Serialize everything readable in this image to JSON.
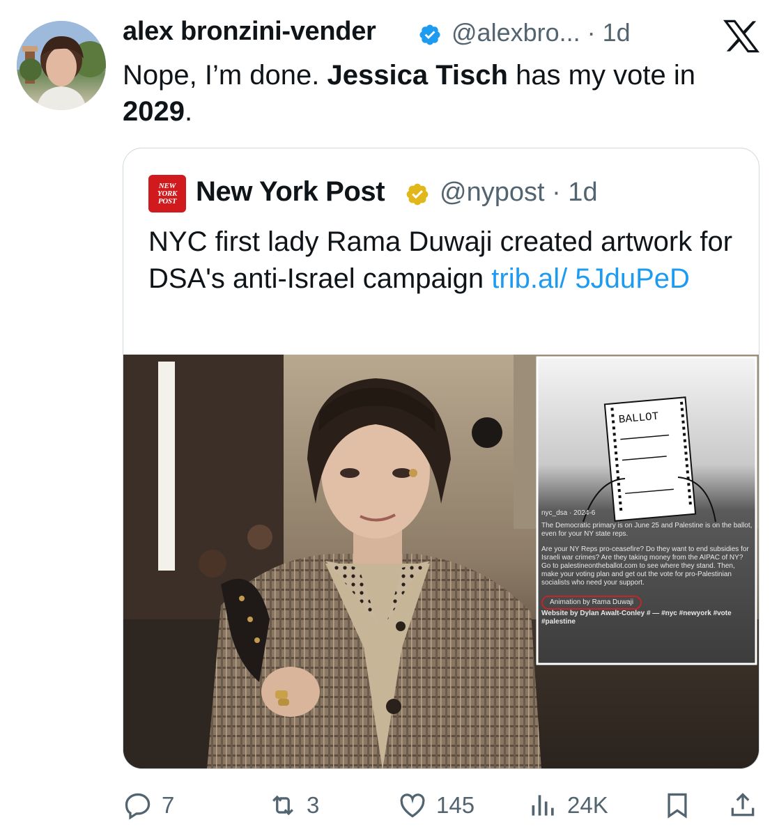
{
  "tweet": {
    "display_name": "alex bronzini-vender",
    "handle_time": "@alexbro... · 1d",
    "text_parts": {
      "plain1": "Nope, I’m done. ",
      "bold1": "Jessica Tisch",
      "plain2": " has my vote in ",
      "bold2": "2029",
      "plain3": "."
    }
  },
  "quote": {
    "logo_text": "NEW YORK POST",
    "display_name": "New York Post",
    "handle_time": "@nypost · 1d",
    "text": "NYC first lady Rama Duwaji created artwork for DSA's anti-Israel campaign ",
    "link": "trib.al/ 5JduPeD"
  },
  "inset": {
    "ballot_title": "BALLOT",
    "caption_user": "nyc_dsa · 2024-6",
    "caption_p1": "The Democratic primary is on June 25 and Palestine is on the ballot, even for your NY state reps.",
    "caption_p2": "Are your NY Reps pro-ceasefire? Do they want to end subsidies for Israeli war crimes? Are they taking money from the AIPAC of NY? Go to palestineontheballot.com to see where they stand. Then, make your voting plan and get out the vote for pro-Palestinian socialists who need your support.",
    "caption_credit1": "Animation by Rama Duwaji",
    "caption_credit2": "Website by Dylan Awalt-Conley # — #nyc #newyork #vote #palestine"
  },
  "actions": {
    "replies": "7",
    "reposts": "3",
    "likes": "145",
    "views": "24K"
  },
  "colors": {
    "verified_blue": "#1d9bf0",
    "verified_gold": "#e2b719",
    "link": "#1d9bf0",
    "muted": "#536471",
    "nyp_red": "#d11a1e"
  },
  "icons": [
    "verified-badge-icon",
    "x-logo-icon",
    "gold-verified-badge-icon",
    "reply-icon",
    "repost-icon",
    "like-icon",
    "views-icon",
    "bookmark-icon",
    "share-icon"
  ]
}
